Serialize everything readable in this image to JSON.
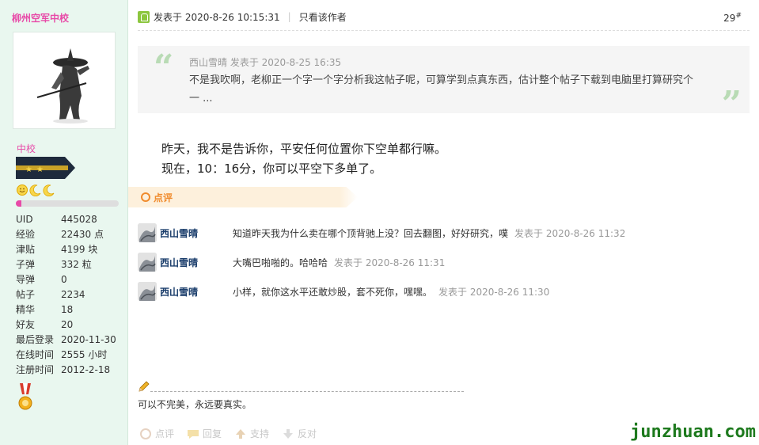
{
  "author": {
    "name": "柳州空军中校",
    "rank_title": "中校",
    "progress_fraction": 0.05,
    "stats": [
      {
        "label": "UID",
        "value": "445028"
      },
      {
        "label": "经验",
        "value": "22430 点"
      },
      {
        "label": "津贴",
        "value": "4199 块"
      },
      {
        "label": "子弹",
        "value": "332 粒"
      },
      {
        "label": "导弹",
        "value": "0"
      },
      {
        "label": "帖子",
        "value": "2234"
      },
      {
        "label": "精华",
        "value": "18"
      },
      {
        "label": "好友",
        "value": "20"
      },
      {
        "label": "最后登录",
        "value": "2020-11-30"
      },
      {
        "label": "在线时间",
        "value": "2555 小时"
      },
      {
        "label": "注册时间",
        "value": "2012-2-18"
      }
    ]
  },
  "post": {
    "posted_at": "发表于 2020-8-26 10:15:31",
    "only_author": "只看该作者",
    "floor": "29",
    "floor_mark": "#",
    "quote": {
      "meta": "西山雪晴 发表于 2020-8-25 16:35",
      "text": "不是我吹啊，老柳正一个字一个字分析我这帖子呢，可算学到点真东西，估计整个帖子下载到电脑里打算研究个一 ..."
    },
    "body_lines": [
      "昨天，我不是告诉你，平安任何位置你下空单都行嘛。",
      "现在，10：16分，你可以平空下多单了。"
    ]
  },
  "reviews": {
    "title": "点评",
    "items": [
      {
        "name": "西山雪晴",
        "text": "知道昨天我为什么卖在哪个顶背驰上没？回去翻图，好好研究，噗",
        "time": "发表于 2020-8-26 11:32"
      },
      {
        "name": "西山雪晴",
        "text": "大嘴巴啪啪的。哈哈哈",
        "time": "发表于 2020-8-26 11:31"
      },
      {
        "name": "西山雪晴",
        "text": "小样，就你这水平还敢炒股，套不死你，嘿嘿。",
        "time": "发表于 2020-8-26 11:30"
      }
    ]
  },
  "signature": "可以不完美，永远要真实。",
  "actions": {
    "review": "点评",
    "reply": "回复",
    "support": "支持",
    "oppose": "反对"
  },
  "watermark": "junzhuan.com",
  "colors": {
    "sidebar_bg": "#e9f7ef",
    "username": "#e84aa8",
    "review_accent": "#f08a2b",
    "watermark": "#1e7a1e"
  }
}
